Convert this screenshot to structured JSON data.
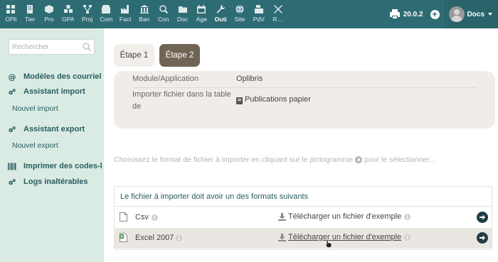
{
  "topnav": {
    "items": [
      {
        "label": "OPli",
        "icon": "grid-icon"
      },
      {
        "label": "Tier",
        "icon": "building-icon"
      },
      {
        "label": "Pro",
        "icon": "cube-icon"
      },
      {
        "label": "GPA",
        "icon": "cubes-icon"
      },
      {
        "label": "Proj",
        "icon": "sitemap-icon"
      },
      {
        "label": "Com",
        "icon": "shop-icon"
      },
      {
        "label": "Fact",
        "icon": "factory-icon"
      },
      {
        "label": "Ban",
        "icon": "bank-icon"
      },
      {
        "label": "Con",
        "icon": "search-money-icon"
      },
      {
        "label": "Doc",
        "icon": "folder-icon"
      },
      {
        "label": "Age",
        "icon": "calendar-icon"
      },
      {
        "label": "Outi",
        "icon": "wrench-icon",
        "active": true
      },
      {
        "label": "Site",
        "icon": "globe-icon"
      },
      {
        "label": "PdV",
        "icon": "cash-register-icon"
      },
      {
        "label": "R…",
        "icon": "tools-icon"
      }
    ]
  },
  "header": {
    "version": "20.0.2",
    "user": "Docs"
  },
  "sidebar": {
    "search_placeholder": "Rechercher",
    "sections": [
      {
        "label": "Modèles des courriel",
        "icon": "at-icon"
      },
      {
        "label": "Assistant import",
        "icon": "gears-icon"
      },
      {
        "label": "Assistant export",
        "icon": "gears-icon"
      },
      {
        "label": "Imprimer des codes-l",
        "icon": "barcode-icon"
      },
      {
        "label": "Logs inaltérables",
        "icon": "gears-icon"
      }
    ],
    "sub_import": "Nouvel import",
    "sub_export": "Nouvel export"
  },
  "main": {
    "tabs": [
      "Étape 1",
      "Étape 2"
    ],
    "active_tab": 1,
    "info": {
      "module_label": "Module/Application",
      "module_value": "Oplibris",
      "import_label_line1": "Importer fichier dans la table",
      "import_label_line2": "de",
      "import_value": "Publications papier"
    },
    "hint_before": "Choisissez le format de fichier à importer en cliquant sur le pictogramme",
    "hint_after": "pour le sélectionner...",
    "formats": {
      "header": "Le fichier à importer doit avoir un des formats suivants",
      "rows": [
        {
          "name": "Csv",
          "download": "Télécharger un fichier d'exemple"
        },
        {
          "name": "Excel 2007",
          "download": "Télécharger un fichier d'exemple"
        }
      ]
    }
  },
  "colors": {
    "topbar": "#2e6c73",
    "sidebar": "#d9ebe3",
    "active_tab": "#706555"
  }
}
